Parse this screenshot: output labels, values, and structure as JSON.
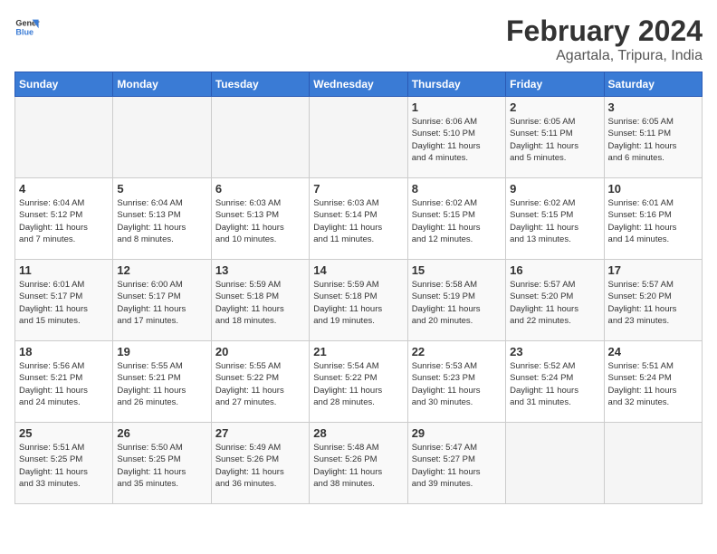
{
  "header": {
    "logo": {
      "general": "General",
      "blue": "Blue"
    },
    "month": "February 2024",
    "location": "Agartala, Tripura, India"
  },
  "days_of_week": [
    "Sunday",
    "Monday",
    "Tuesday",
    "Wednesday",
    "Thursday",
    "Friday",
    "Saturday"
  ],
  "weeks": [
    [
      {
        "day": "",
        "info": ""
      },
      {
        "day": "",
        "info": ""
      },
      {
        "day": "",
        "info": ""
      },
      {
        "day": "",
        "info": ""
      },
      {
        "day": "1",
        "info": "Sunrise: 6:06 AM\nSunset: 5:10 PM\nDaylight: 11 hours\nand 4 minutes."
      },
      {
        "day": "2",
        "info": "Sunrise: 6:05 AM\nSunset: 5:11 PM\nDaylight: 11 hours\nand 5 minutes."
      },
      {
        "day": "3",
        "info": "Sunrise: 6:05 AM\nSunset: 5:11 PM\nDaylight: 11 hours\nand 6 minutes."
      }
    ],
    [
      {
        "day": "4",
        "info": "Sunrise: 6:04 AM\nSunset: 5:12 PM\nDaylight: 11 hours\nand 7 minutes."
      },
      {
        "day": "5",
        "info": "Sunrise: 6:04 AM\nSunset: 5:13 PM\nDaylight: 11 hours\nand 8 minutes."
      },
      {
        "day": "6",
        "info": "Sunrise: 6:03 AM\nSunset: 5:13 PM\nDaylight: 11 hours\nand 10 minutes."
      },
      {
        "day": "7",
        "info": "Sunrise: 6:03 AM\nSunset: 5:14 PM\nDaylight: 11 hours\nand 11 minutes."
      },
      {
        "day": "8",
        "info": "Sunrise: 6:02 AM\nSunset: 5:15 PM\nDaylight: 11 hours\nand 12 minutes."
      },
      {
        "day": "9",
        "info": "Sunrise: 6:02 AM\nSunset: 5:15 PM\nDaylight: 11 hours\nand 13 minutes."
      },
      {
        "day": "10",
        "info": "Sunrise: 6:01 AM\nSunset: 5:16 PM\nDaylight: 11 hours\nand 14 minutes."
      }
    ],
    [
      {
        "day": "11",
        "info": "Sunrise: 6:01 AM\nSunset: 5:17 PM\nDaylight: 11 hours\nand 15 minutes."
      },
      {
        "day": "12",
        "info": "Sunrise: 6:00 AM\nSunset: 5:17 PM\nDaylight: 11 hours\nand 17 minutes."
      },
      {
        "day": "13",
        "info": "Sunrise: 5:59 AM\nSunset: 5:18 PM\nDaylight: 11 hours\nand 18 minutes."
      },
      {
        "day": "14",
        "info": "Sunrise: 5:59 AM\nSunset: 5:18 PM\nDaylight: 11 hours\nand 19 minutes."
      },
      {
        "day": "15",
        "info": "Sunrise: 5:58 AM\nSunset: 5:19 PM\nDaylight: 11 hours\nand 20 minutes."
      },
      {
        "day": "16",
        "info": "Sunrise: 5:57 AM\nSunset: 5:20 PM\nDaylight: 11 hours\nand 22 minutes."
      },
      {
        "day": "17",
        "info": "Sunrise: 5:57 AM\nSunset: 5:20 PM\nDaylight: 11 hours\nand 23 minutes."
      }
    ],
    [
      {
        "day": "18",
        "info": "Sunrise: 5:56 AM\nSunset: 5:21 PM\nDaylight: 11 hours\nand 24 minutes."
      },
      {
        "day": "19",
        "info": "Sunrise: 5:55 AM\nSunset: 5:21 PM\nDaylight: 11 hours\nand 26 minutes."
      },
      {
        "day": "20",
        "info": "Sunrise: 5:55 AM\nSunset: 5:22 PM\nDaylight: 11 hours\nand 27 minutes."
      },
      {
        "day": "21",
        "info": "Sunrise: 5:54 AM\nSunset: 5:22 PM\nDaylight: 11 hours\nand 28 minutes."
      },
      {
        "day": "22",
        "info": "Sunrise: 5:53 AM\nSunset: 5:23 PM\nDaylight: 11 hours\nand 30 minutes."
      },
      {
        "day": "23",
        "info": "Sunrise: 5:52 AM\nSunset: 5:24 PM\nDaylight: 11 hours\nand 31 minutes."
      },
      {
        "day": "24",
        "info": "Sunrise: 5:51 AM\nSunset: 5:24 PM\nDaylight: 11 hours\nand 32 minutes."
      }
    ],
    [
      {
        "day": "25",
        "info": "Sunrise: 5:51 AM\nSunset: 5:25 PM\nDaylight: 11 hours\nand 33 minutes."
      },
      {
        "day": "26",
        "info": "Sunrise: 5:50 AM\nSunset: 5:25 PM\nDaylight: 11 hours\nand 35 minutes."
      },
      {
        "day": "27",
        "info": "Sunrise: 5:49 AM\nSunset: 5:26 PM\nDaylight: 11 hours\nand 36 minutes."
      },
      {
        "day": "28",
        "info": "Sunrise: 5:48 AM\nSunset: 5:26 PM\nDaylight: 11 hours\nand 38 minutes."
      },
      {
        "day": "29",
        "info": "Sunrise: 5:47 AM\nSunset: 5:27 PM\nDaylight: 11 hours\nand 39 minutes."
      },
      {
        "day": "",
        "info": ""
      },
      {
        "day": "",
        "info": ""
      }
    ]
  ]
}
